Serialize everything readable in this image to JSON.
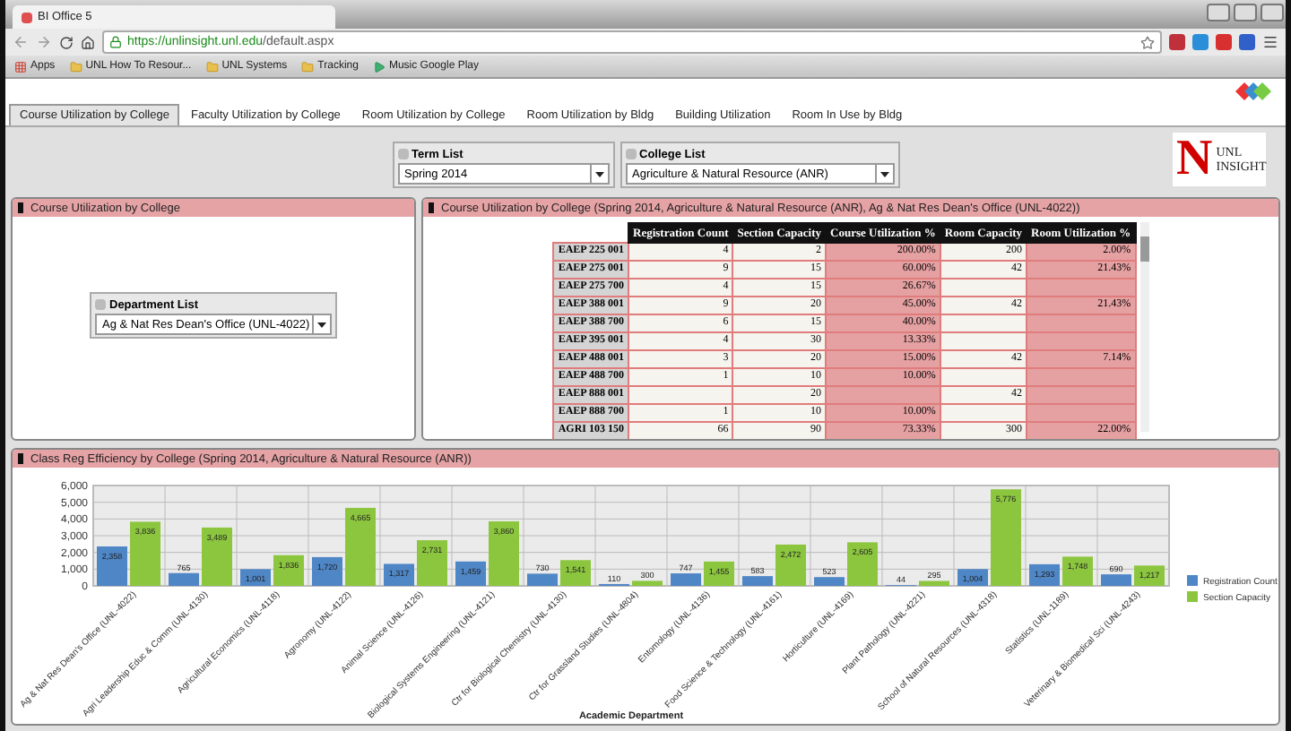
{
  "browser": {
    "tab_title": "BI Office 5",
    "url_host": "https://unlinsight.unl.edu",
    "url_path": "/default.aspx",
    "bookmarks": [
      {
        "label": "Apps",
        "kind": "apps"
      },
      {
        "label": "UNL How To Resour...",
        "kind": "folder"
      },
      {
        "label": "UNL Systems",
        "kind": "folder"
      },
      {
        "label": "Tracking",
        "kind": "folder"
      },
      {
        "label": "Music Google Play",
        "kind": "play"
      }
    ]
  },
  "tabs": [
    {
      "label": "Course Utilization by College",
      "selected": true
    },
    {
      "label": "Faculty Utilization by College",
      "selected": false
    },
    {
      "label": "Room Utilization by College",
      "selected": false
    },
    {
      "label": "Room Utilization by Bldg",
      "selected": false
    },
    {
      "label": "Building Utilization",
      "selected": false
    },
    {
      "label": "Room In Use by Bldg",
      "selected": false
    }
  ],
  "filters": [
    {
      "label": "Term List",
      "value": "Spring 2014"
    },
    {
      "label": "College List",
      "value": "Agriculture & Natural Resource (ANR)"
    }
  ],
  "logo": {
    "mark": "N",
    "line1": "UNL",
    "line2": "INSIGHT"
  },
  "left_panel": {
    "title": "Course Utilization by College",
    "filter": {
      "label": "Department List",
      "value": "Ag & Nat Res Dean's Office (UNL-4022)"
    }
  },
  "table_panel": {
    "title": "Course Utilization by College  (Spring 2014, Agriculture & Natural Resource (ANR), Ag & Nat Res Dean's Office (UNL-4022))",
    "columns": [
      "Registration Count",
      "Section Capacity",
      "Course Utilization %",
      "Room Capacity",
      "Room Utilization %"
    ],
    "rows": [
      {
        "course": "EAEP 225 001",
        "cells": [
          "4",
          "2",
          "200.00%",
          "200",
          "2.00%"
        ]
      },
      {
        "course": "EAEP 275 001",
        "cells": [
          "9",
          "15",
          "60.00%",
          "42",
          "21.43%"
        ]
      },
      {
        "course": "EAEP 275 700",
        "cells": [
          "4",
          "15",
          "26.67%",
          null,
          null
        ]
      },
      {
        "course": "EAEP 388 001",
        "cells": [
          "9",
          "20",
          "45.00%",
          "42",
          "21.43%"
        ]
      },
      {
        "course": "EAEP 388 700",
        "cells": [
          "6",
          "15",
          "40.00%",
          null,
          null
        ]
      },
      {
        "course": "EAEP 395 001",
        "cells": [
          "4",
          "30",
          "13.33%",
          null,
          null
        ]
      },
      {
        "course": "EAEP 488 001",
        "cells": [
          "3",
          "20",
          "15.00%",
          "42",
          "7.14%"
        ]
      },
      {
        "course": "EAEP 488 700",
        "cells": [
          "1",
          "10",
          "10.00%",
          null,
          null
        ]
      },
      {
        "course": "EAEP 888 001",
        "cells": [
          null,
          "20",
          null,
          "42",
          null
        ]
      },
      {
        "course": "EAEP 888 700",
        "cells": [
          "1",
          "10",
          "10.00%",
          null,
          null
        ]
      },
      {
        "course": "AGRI 103 150",
        "cells": [
          "66",
          "90",
          "73.33%",
          "300",
          "22.00%"
        ]
      }
    ]
  },
  "chart_panel": {
    "title": "Class Reg Efficiency by College  (Spring 2014, Agriculture & Natural Resource (ANR))",
    "chart_data": {
      "type": "bar",
      "xlabel": "Academic Department",
      "categories": [
        "Ag & Nat Res Dean's Office (UNL-4022)",
        "Agri Leadership Educ & Comm (UNL-4130)",
        "Agricultural Economics (UNL-4118)",
        "Agronomy (UNL-4122)",
        "Animal Science (UNL-4126)",
        "Biological Systems Engineering (UNL-4121)",
        "Ctr for Biological Chemistry (UNL-4130)",
        "Ctr for Grassland Studies (UNL-4804)",
        "Entomology (UNL-4136)",
        "Food Science & Technology (UNL-4161)",
        "Horticulture (UNL-4169)",
        "Plant Pathology (UNL-4221)",
        "School of Natural Resources (UNL-4318)",
        "Statistics (UNL-1189)",
        "Veterinary & Biomedical Sci (UNL-4243)"
      ],
      "series": [
        {
          "name": "Registration Count",
          "color": "#4f86c6",
          "values": [
            2358,
            765,
            1001,
            1720,
            1317,
            1459,
            730,
            110,
            747,
            583,
            523,
            44,
            1004,
            1293,
            690
          ]
        },
        {
          "name": "Section Capacity",
          "color": "#8cc63f",
          "values": [
            3836,
            3489,
            1836,
            4665,
            2731,
            3860,
            1541,
            300,
            1455,
            2472,
            2605,
            295,
            5776,
            1748,
            1217
          ]
        }
      ],
      "ylim": [
        0,
        6000
      ],
      "yticks": [
        {
          "value": 0,
          "label": "0"
        },
        {
          "value": 1000,
          "label": "1,000"
        },
        {
          "value": 2000,
          "label": "2,000"
        },
        {
          "value": 3000,
          "label": "3,000"
        },
        {
          "value": 4000,
          "label": "4,000"
        },
        {
          "value": 5000,
          "label": "5,000"
        },
        {
          "value": 6000,
          "label": "6,000"
        }
      ],
      "value_labels": [
        [
          "2,358",
          "765",
          "1,001",
          "1,720",
          "1,317",
          "1,459",
          "730",
          "110",
          "747",
          "583",
          "523",
          "44",
          "1,004",
          "1,293",
          "690"
        ],
        [
          "3,836",
          "3,489",
          "1,836",
          "4,665",
          "2,731",
          "3,860",
          "1,541",
          "300",
          "1,455",
          "2,472",
          "2,605",
          "295",
          "5,776",
          "1,748",
          "1,217"
        ]
      ],
      "grid": true,
      "legend": true
    }
  }
}
